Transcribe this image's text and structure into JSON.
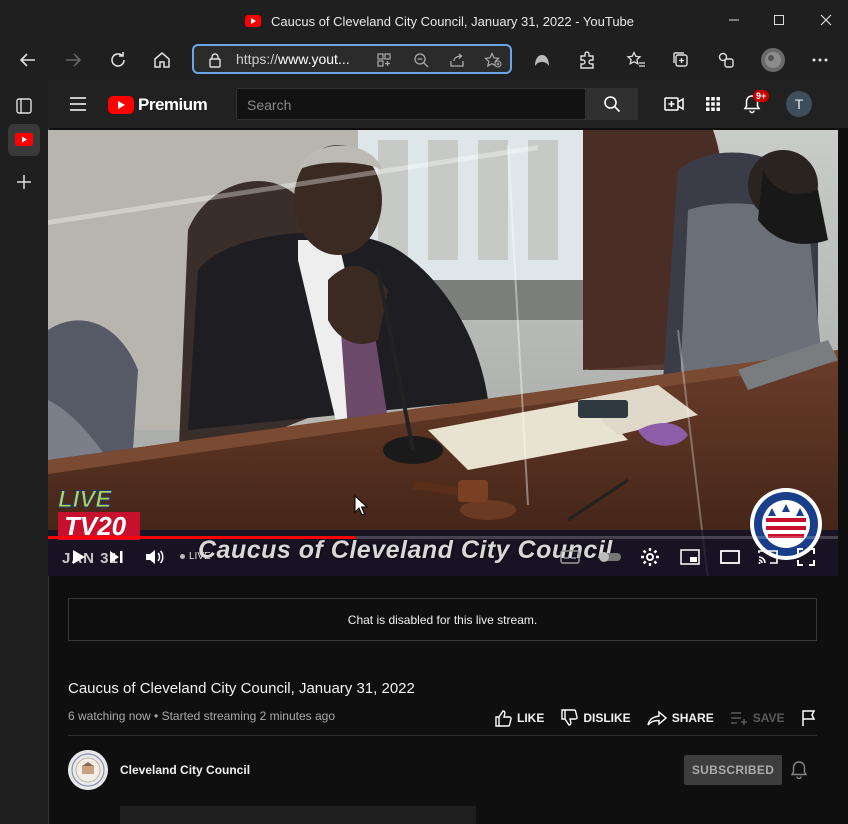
{
  "window": {
    "title": "Caucus of Cleveland City Council, January 31, 2022 - YouTube",
    "minimize_glyph": "—",
    "maximize_glyph": "☐",
    "close_glyph": "✕"
  },
  "browser": {
    "url_prefix": "https://",
    "url_host": "www.yout...",
    "icons": [
      "back-arrow-icon",
      "forward-arrow-icon",
      "refresh-icon",
      "home-icon",
      "lock-icon",
      "app-grid-icon",
      "zoom-out-icon",
      "share-icon",
      "favorite-add-icon",
      "profile-mask-icon",
      "extensions-icon",
      "favorites-icon",
      "collections-icon",
      "split-screen-icon",
      "avatar",
      "more-icon"
    ]
  },
  "sidebar": {
    "items": [
      "tabs-icon",
      "youtube-tab-icon",
      "add-tab-icon"
    ]
  },
  "youtube_header": {
    "logo_text": "Premium",
    "search_placeholder": "Search",
    "notification_count": "9+",
    "avatar_letter": "T"
  },
  "player": {
    "caption_overlay": "Caucus of Cleveland City Council",
    "date_overlay": "JAN 31",
    "station_logo_top": "LIVE",
    "station_logo_bottom": "TV20",
    "live_label": "LIVE",
    "progress_fraction": 0.39,
    "accent_color": "#ff0000"
  },
  "chat": {
    "message": "Chat is disabled for this live stream."
  },
  "video": {
    "title": "Caucus of Cleveland City Council, January 31, 2022",
    "meta": "6 watching now • Started streaming 2 minutes ago",
    "actions": {
      "like": "LIKE",
      "dislike": "DISLIKE",
      "share": "SHARE",
      "save": "SAVE"
    }
  },
  "channel": {
    "name": "Cleveland City Council",
    "subscribe_label": "SUBSCRIBED"
  }
}
